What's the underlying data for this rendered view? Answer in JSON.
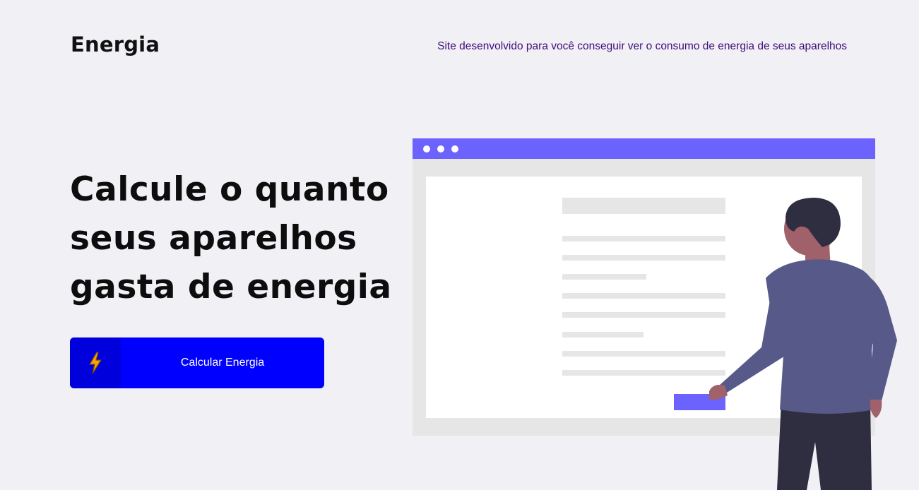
{
  "header": {
    "logo": "Energia",
    "tagline": "Site desenvolvido para você conseguir ver o consumo de energia de seus aparelhos"
  },
  "hero": {
    "title": "Calcule o quanto seus aparelhos gasta de energia",
    "cta_label": "Calcular Energia"
  },
  "icons": {
    "cta_icon": "lightning-bolt-icon"
  },
  "colors": {
    "background": "#f0f0f5",
    "tagline": "#3f0c7a",
    "cta": "#0000ff",
    "cta_icon_box": "#0000dd",
    "bolt": "#f7a30e",
    "browser_bar": "#6c63ff",
    "person_shirt": "#575a89",
    "person_pants": "#2f2e41",
    "person_skin": "#a0616a"
  }
}
